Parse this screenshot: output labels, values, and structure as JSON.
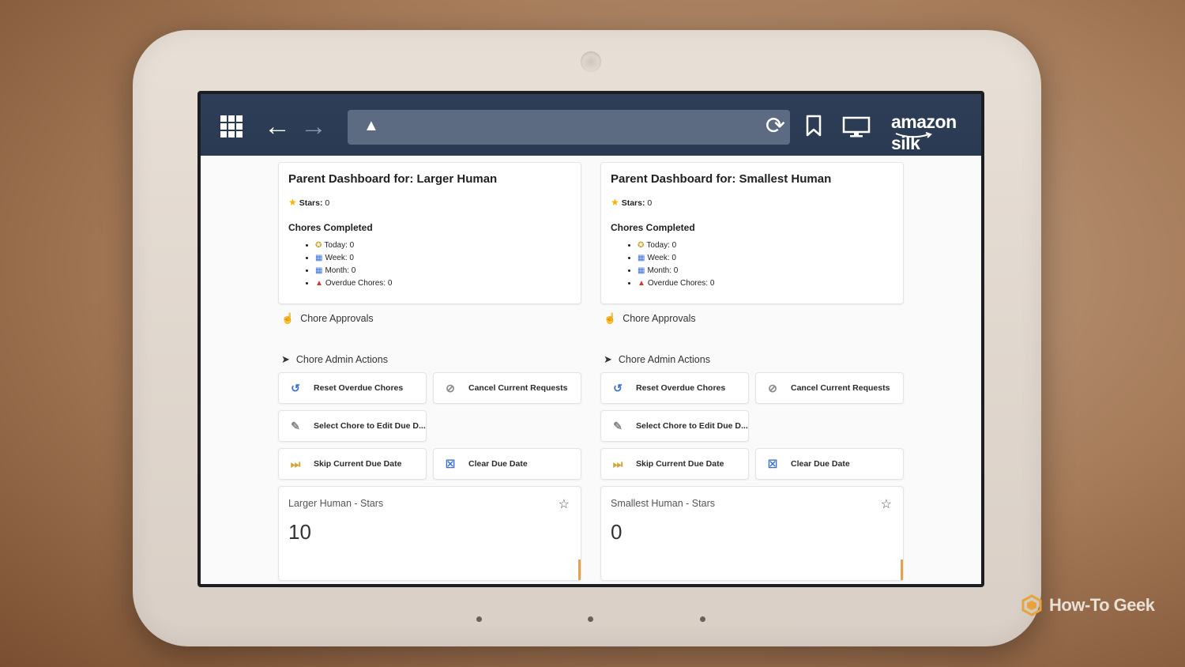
{
  "browser": {
    "brand": "amazon silk",
    "icons": [
      "apps-grid-icon",
      "back-arrow-icon",
      "forward-arrow-icon",
      "warning-icon",
      "reload-icon",
      "bookmark-icon",
      "desktop-mode-icon"
    ]
  },
  "left": {
    "dashboard": {
      "title": "Parent Dashboard for: Larger Human",
      "stars_label": "Stars:",
      "stars_value": "0",
      "chores_heading": "Chores Completed",
      "today": "Today: 0",
      "week": "Week: 0",
      "month": "Month: 0",
      "overdue": "Overdue Chores: 0"
    },
    "approvals_label": "Chore Approvals",
    "admin_label": "Chore Admin Actions",
    "buttons": {
      "reset": "Reset Overdue Chores",
      "cancel": "Cancel Current Requests",
      "select": "Select Chore to Edit Due D...",
      "skip": "Skip Current Due Date",
      "clear": "Clear Due Date"
    },
    "stat": {
      "title": "Larger Human - Stars",
      "value": "10"
    }
  },
  "right": {
    "dashboard": {
      "title": "Parent Dashboard for: Smallest Human",
      "stars_label": "Stars:",
      "stars_value": "0",
      "chores_heading": "Chores Completed",
      "today": "Today: 0",
      "week": "Week: 0",
      "month": "Month: 0",
      "overdue": "Overdue Chores: 0"
    },
    "approvals_label": "Chore Approvals",
    "admin_label": "Chore Admin Actions",
    "buttons": {
      "reset": "Reset Overdue Chores",
      "cancel": "Cancel Current Requests",
      "select": "Select Chore to Edit Due D...",
      "skip": "Skip Current Due Date",
      "clear": "Clear Due Date"
    },
    "stat": {
      "title": "Smallest Human - Stars",
      "value": "0"
    }
  },
  "watermark": "How-To Geek",
  "colors": {
    "topbar": "#2e3e57",
    "url_bar": "#5c6a82",
    "accent_blue": "#3b6fd6",
    "star_gold": "#f4b400"
  }
}
